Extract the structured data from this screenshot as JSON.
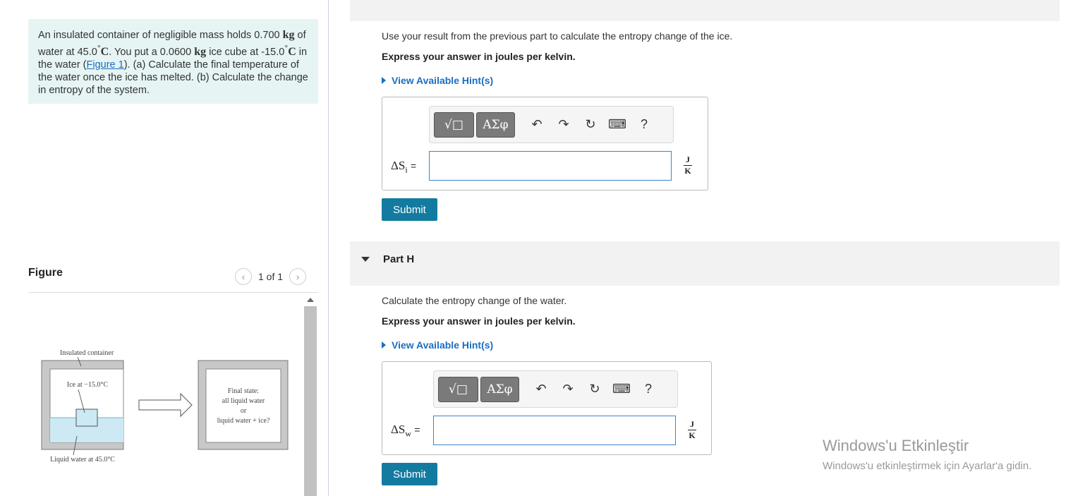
{
  "problem": {
    "p1": "An insulated container of negligible mass holds 0.700 ",
    "kg": "kg",
    "p2": " of water at 45.0",
    "deg": "°",
    "C": "C",
    "p3": ". You put a 0.0600 ",
    "p4": " ice cube at -15.0",
    "p5": " in the water (",
    "figure_link": "Figure 1",
    "p6": "). (a) Calculate the final temperature of the water once the ice has melted. (b) Calculate the change in entropy of the system."
  },
  "figure": {
    "title": "Figure",
    "page_indicator": "1 of 1",
    "labels": {
      "insulated": "Insulated container",
      "ice": "Ice at −15.0°C",
      "liquid": "Liquid water at 45.0°C",
      "final1": "Final state:",
      "final2": "all liquid water",
      "final3": "or",
      "final4": "liquid water + ice?"
    }
  },
  "partG": {
    "prompt": "Use your result from the previous part to calculate the entropy change of the ice.",
    "instruction": "Express your answer in joules per kelvin.",
    "hint": "View Available Hint(s)",
    "var_main": "ΔS",
    "var_sub": "i",
    "equals": "=",
    "value": "",
    "unit_num": "J",
    "unit_den": "K",
    "submit": "Submit"
  },
  "partH": {
    "title": "Part H",
    "prompt": "Calculate the entropy change of the water.",
    "instruction": "Express your answer in joules per kelvin.",
    "hint": "View Available Hint(s)",
    "var_main": "ΔS",
    "var_sub": "w",
    "equals": "=",
    "value": "",
    "unit_num": "J",
    "unit_den": "K",
    "submit": "Submit"
  },
  "toolbar": {
    "templates_label": "√□",
    "greek_label": "ΑΣφ",
    "help_label": "?"
  },
  "watermark": {
    "line1": "Windows'u Etkinleştir",
    "line2": "Windows'u etkinleştirmek için Ayarlar'a gidin."
  },
  "colors": {
    "accent": "#137ba0",
    "link": "#1a6ec1",
    "problem_bg": "#e6f4f4",
    "water": "#cce9f4"
  }
}
